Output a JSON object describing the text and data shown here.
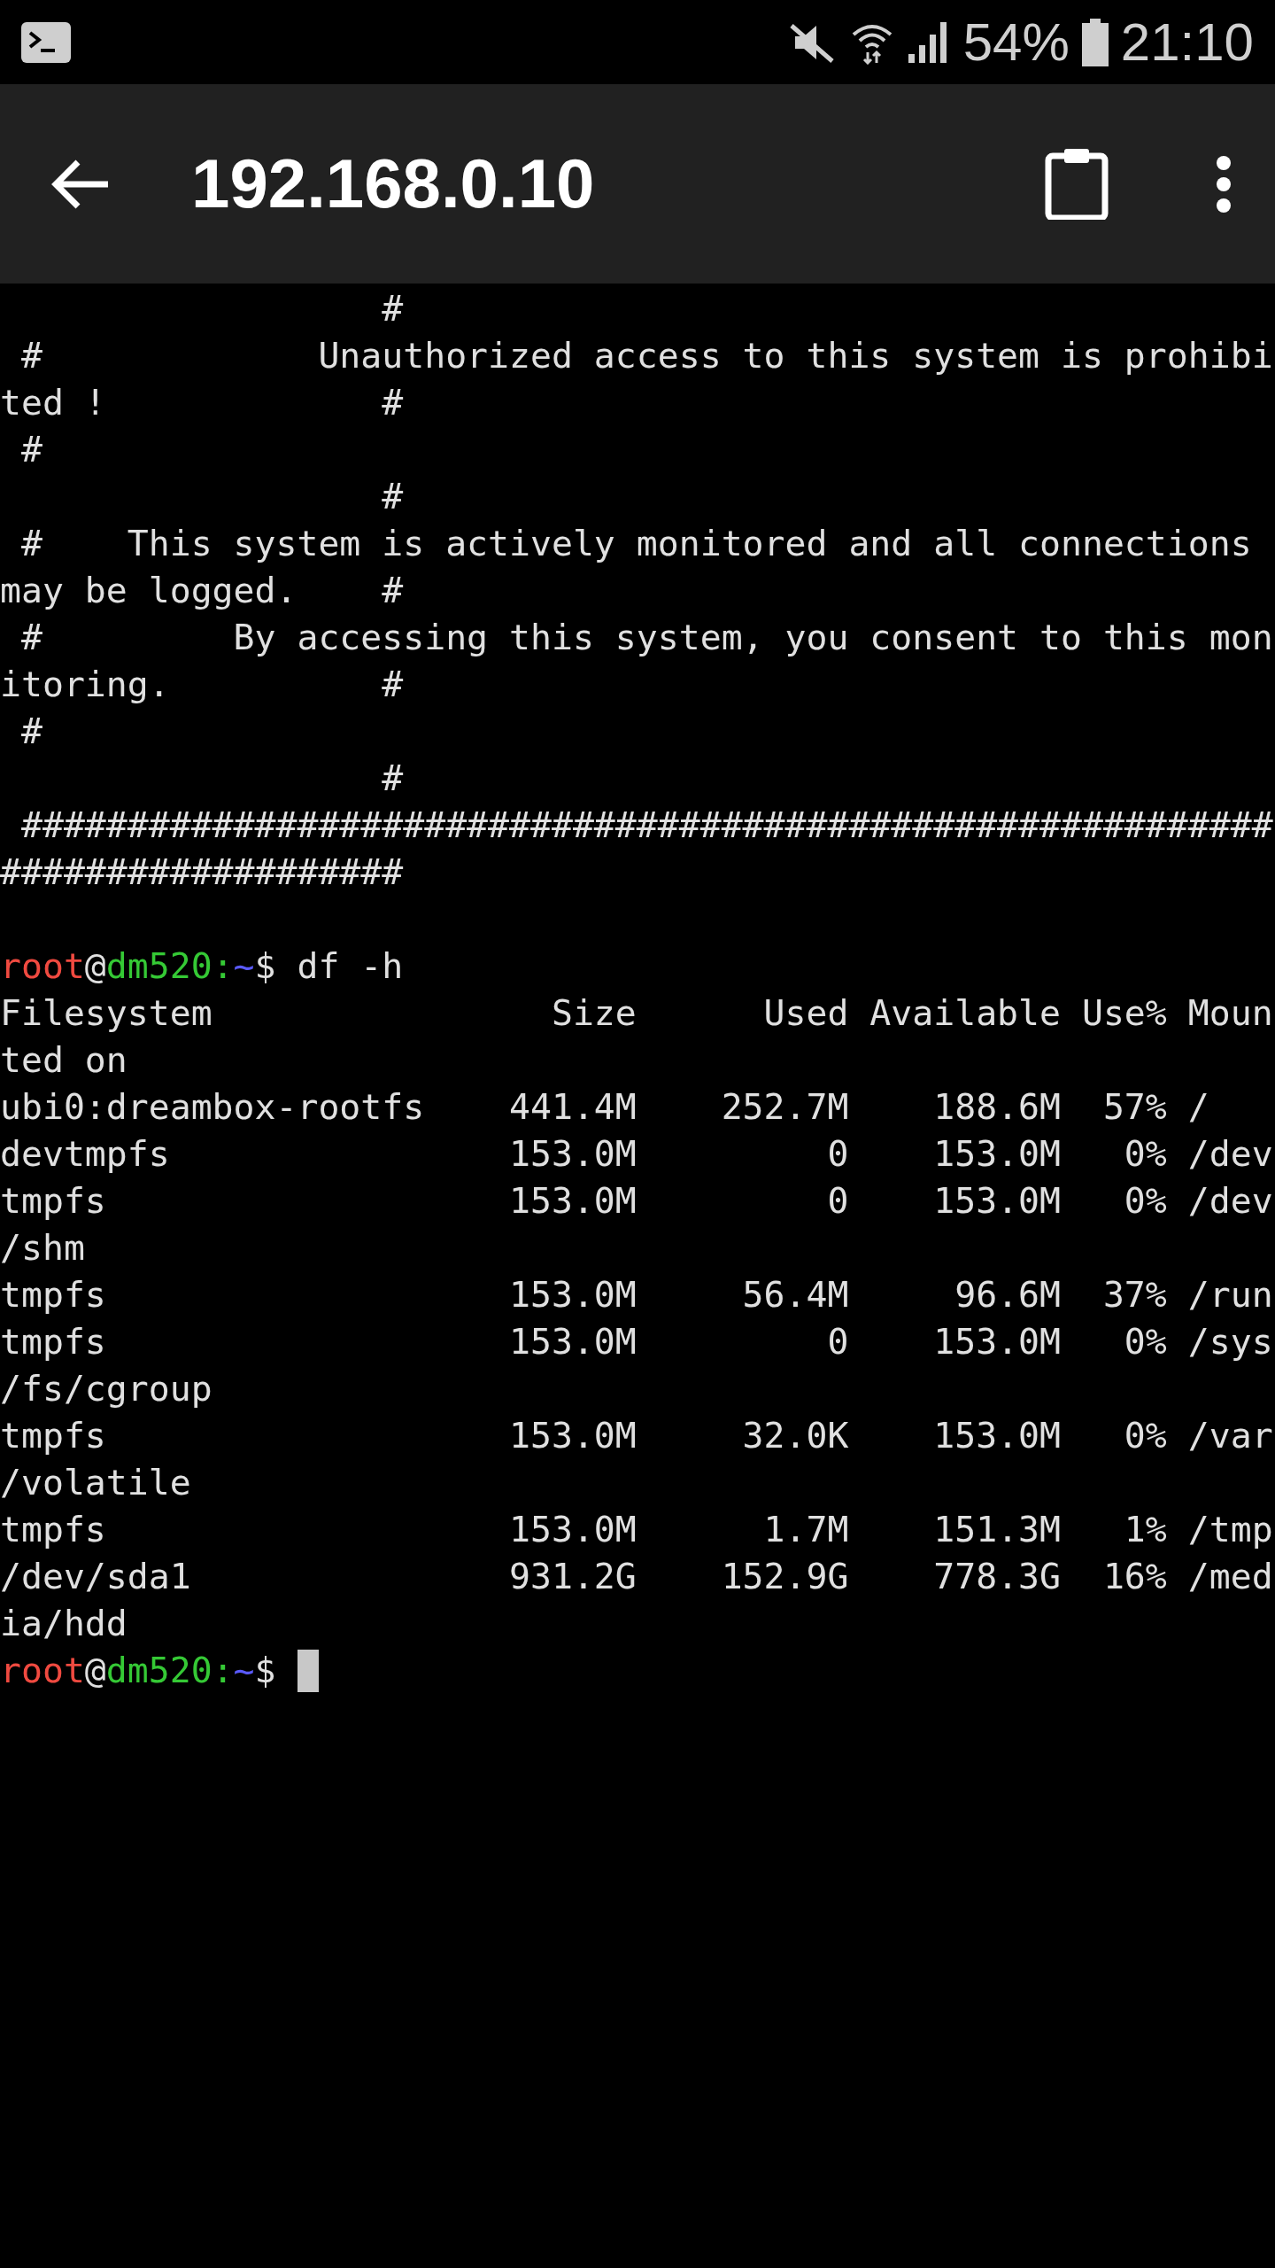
{
  "status_bar": {
    "battery": "54%",
    "time": "21:10"
  },
  "app_bar": {
    "title": "192.168.0.10"
  },
  "terminal": {
    "lines": [
      {
        "kind": "text",
        "text": "                  #"
      },
      {
        "kind": "text",
        "text": " #             Unauthorized access to this system is prohibi"
      },
      {
        "kind": "text",
        "text": "ted !             #"
      },
      {
        "kind": "text",
        "text": " #"
      },
      {
        "kind": "text",
        "text": "                  #"
      },
      {
        "kind": "text",
        "text": " #    This system is actively monitored and all connections "
      },
      {
        "kind": "text",
        "text": "may be logged.    #"
      },
      {
        "kind": "text",
        "text": " #         By accessing this system, you consent to this mon"
      },
      {
        "kind": "text",
        "text": "itoring.          #"
      },
      {
        "kind": "text",
        "text": " #"
      },
      {
        "kind": "text",
        "text": "                  #"
      },
      {
        "kind": "text",
        "text": " ###########################################################"
      },
      {
        "kind": "text",
        "text": "###################"
      },
      {
        "kind": "blank"
      },
      {
        "kind": "prompt",
        "segments": [
          {
            "text": "root",
            "color": "#f04a40"
          },
          {
            "text": "@",
            "color": "#e0e0e0"
          },
          {
            "text": "dm520",
            "color": "#35c935"
          },
          {
            "text": ":",
            "color": "#35c935"
          },
          {
            "text": "~",
            "color": "#5a5aff"
          },
          {
            "text": "$",
            "color": "#e0e0e0"
          }
        ],
        "command": "df -h",
        "cursor": false
      },
      {
        "kind": "text",
        "text": "Filesystem                Size      Used Available Use% Moun"
      },
      {
        "kind": "text",
        "text": "ted on"
      },
      {
        "kind": "text",
        "text": "ubi0:dreambox-rootfs    441.4M    252.7M    188.6M  57% /"
      },
      {
        "kind": "text",
        "text": "devtmpfs                153.0M         0    153.0M   0% /dev"
      },
      {
        "kind": "text",
        "text": "tmpfs                   153.0M         0    153.0M   0% /dev"
      },
      {
        "kind": "text",
        "text": "/shm"
      },
      {
        "kind": "text",
        "text": "tmpfs                   153.0M     56.4M     96.6M  37% /run"
      },
      {
        "kind": "text",
        "text": "tmpfs                   153.0M         0    153.0M   0% /sys"
      },
      {
        "kind": "text",
        "text": "/fs/cgroup"
      },
      {
        "kind": "text",
        "text": "tmpfs                   153.0M     32.0K    153.0M   0% /var"
      },
      {
        "kind": "text",
        "text": "/volatile"
      },
      {
        "kind": "text",
        "text": "tmpfs                   153.0M      1.7M    151.3M   1% /tmp"
      },
      {
        "kind": "text",
        "text": "/dev/sda1               931.2G    152.9G    778.3G  16% /med"
      },
      {
        "kind": "text",
        "text": "ia/hdd"
      },
      {
        "kind": "prompt",
        "segments": [
          {
            "text": "root",
            "color": "#f04a40"
          },
          {
            "text": "@",
            "color": "#e0e0e0"
          },
          {
            "text": "dm520",
            "color": "#35c935"
          },
          {
            "text": ":",
            "color": "#35c935"
          },
          {
            "text": "~",
            "color": "#5a5aff"
          },
          {
            "text": "$",
            "color": "#e0e0e0"
          }
        ],
        "cursor": true
      }
    ]
  }
}
